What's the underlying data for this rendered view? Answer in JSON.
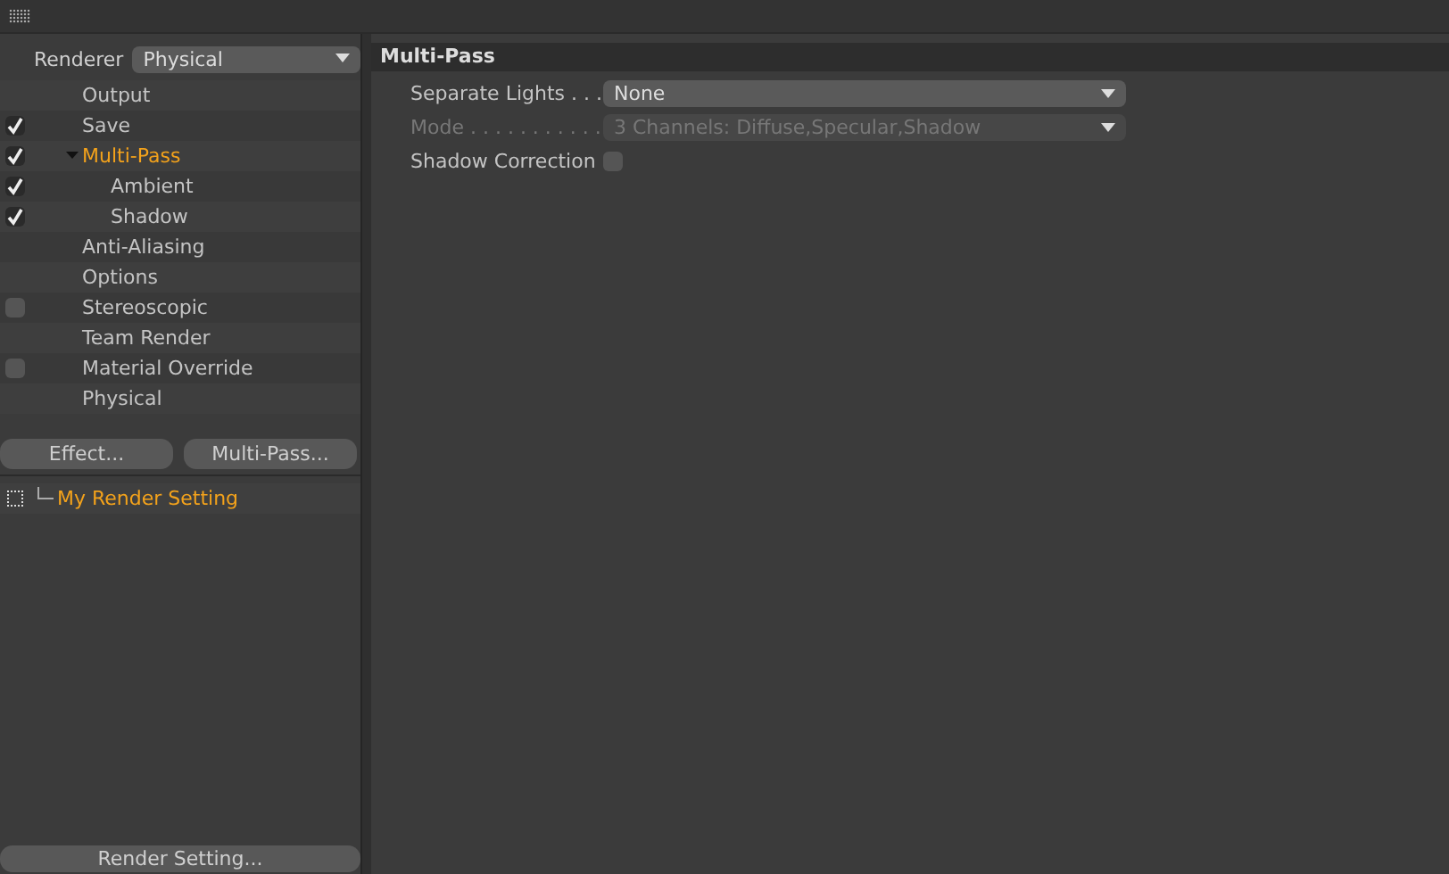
{
  "renderer": {
    "label": "Renderer",
    "value": "Physical"
  },
  "tree": [
    {
      "label": "Output",
      "kind": "plain",
      "selected": false
    },
    {
      "label": "Save",
      "kind": "checkbox",
      "checked": true,
      "selected": false
    },
    {
      "label": "Multi-Pass",
      "kind": "checkbox",
      "checked": true,
      "selected": true,
      "expanded": true,
      "children": [
        {
          "label": "Ambient",
          "kind": "checkbox",
          "checked": true,
          "selected": false
        },
        {
          "label": "Shadow",
          "kind": "checkbox",
          "checked": true,
          "selected": false
        }
      ]
    },
    {
      "label": "Anti-Aliasing",
      "kind": "plain",
      "selected": false
    },
    {
      "label": "Options",
      "kind": "plain",
      "selected": false
    },
    {
      "label": "Stereoscopic",
      "kind": "checkbox",
      "checked": false,
      "selected": false
    },
    {
      "label": "Team Render",
      "kind": "plain",
      "selected": false
    },
    {
      "label": "Material Override",
      "kind": "checkbox",
      "checked": false,
      "selected": false
    },
    {
      "label": "Physical",
      "kind": "plain",
      "selected": false
    }
  ],
  "buttons": [
    "Effect...",
    "Multi-Pass..."
  ],
  "settings_list": [
    {
      "label": "My Render Setting",
      "selected": true
    }
  ],
  "bottom_button": "Render Setting...",
  "panel": {
    "title": "Multi-Pass",
    "fields": [
      {
        "kind": "dropdown",
        "label": "Separate Lights . . .",
        "value": "None",
        "disabled": false
      },
      {
        "kind": "dropdown",
        "label": "Mode . . . . . . . . . . .",
        "value": "3 Channels: Diffuse,Specular,Shadow",
        "disabled": true
      },
      {
        "kind": "checkbox",
        "label": "Shadow Correction",
        "checked": false,
        "disabled": false
      }
    ]
  }
}
